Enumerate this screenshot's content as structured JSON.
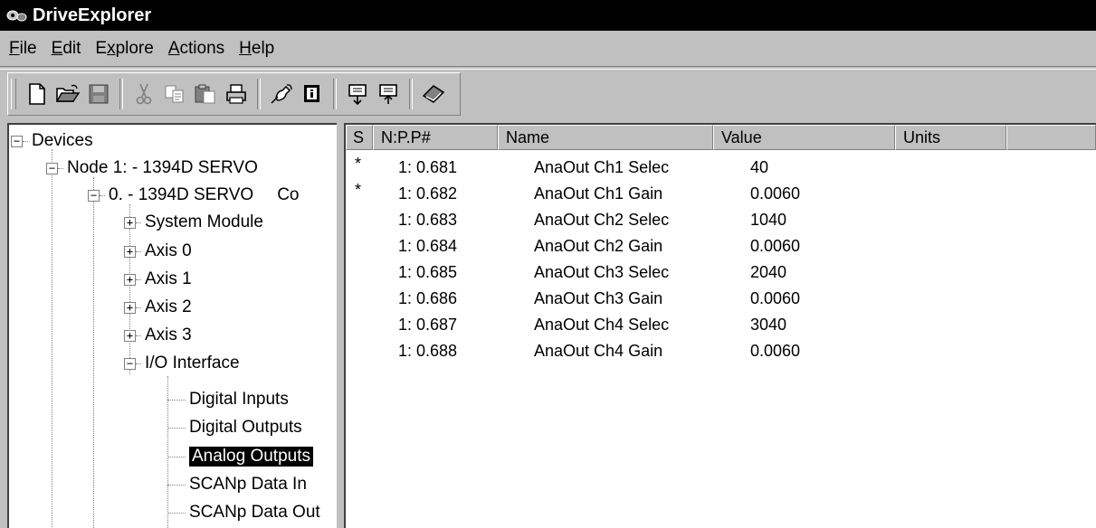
{
  "window": {
    "title": "DriveExplorer"
  },
  "menu": [
    {
      "pre": "",
      "u": "F",
      "post": "ile"
    },
    {
      "pre": "",
      "u": "E",
      "post": "dit"
    },
    {
      "pre": "E",
      "u": "x",
      "post": "plore"
    },
    {
      "pre": "",
      "u": "A",
      "post": "ctions"
    },
    {
      "pre": "",
      "u": "H",
      "post": "elp"
    }
  ],
  "toolbar_icons": [
    "new-icon",
    "open-icon",
    "save-icon",
    "cut-icon",
    "copy-icon",
    "paste-icon",
    "print-icon",
    "connect-icon",
    "properties-icon",
    "upload-icon",
    "download-icon",
    "help-book-icon"
  ],
  "tree": {
    "devices": "Devices",
    "node1": "Node 1: - 1394D SERVO",
    "device0": "0. - 1394D SERVO",
    "device0_suffix": "Co",
    "system_module": "System Module",
    "axis0": "Axis 0",
    "axis1": "Axis 1",
    "axis2": "Axis 2",
    "axis3": "Axis 3",
    "io_interface": "I/O Interface",
    "digital_inputs": "Digital Inputs",
    "digital_outputs": "Digital Outputs",
    "analog_outputs": "Analog Outputs",
    "scanp_in": "SCANp Data In",
    "scanp_out": "SCANp Data Out"
  },
  "list": {
    "columns": {
      "s": "S",
      "npp": "N:P.P#",
      "name": "Name",
      "value": "Value",
      "units": "Units"
    },
    "rows": [
      {
        "s": "*",
        "npp": "1: 0.681",
        "name": "AnaOut Ch1 Selec",
        "value": "40",
        "units": ""
      },
      {
        "s": "*",
        "npp": "1: 0.682",
        "name": "AnaOut Ch1 Gain",
        "value": "0.0060",
        "units": ""
      },
      {
        "s": "",
        "npp": "1: 0.683",
        "name": "AnaOut Ch2 Selec",
        "value": "1040",
        "units": ""
      },
      {
        "s": "",
        "npp": "1: 0.684",
        "name": "AnaOut Ch2 Gain",
        "value": "0.0060",
        "units": ""
      },
      {
        "s": "",
        "npp": "1: 0.685",
        "name": "AnaOut Ch3 Selec",
        "value": "2040",
        "units": ""
      },
      {
        "s": "",
        "npp": "1: 0.686",
        "name": "AnaOut Ch3 Gain",
        "value": "0.0060",
        "units": ""
      },
      {
        "s": "",
        "npp": "1: 0.687",
        "name": "AnaOut Ch4 Selec",
        "value": "3040",
        "units": ""
      },
      {
        "s": "",
        "npp": "1: 0.688",
        "name": "AnaOut Ch4 Gain",
        "value": "0.0060",
        "units": ""
      }
    ]
  }
}
